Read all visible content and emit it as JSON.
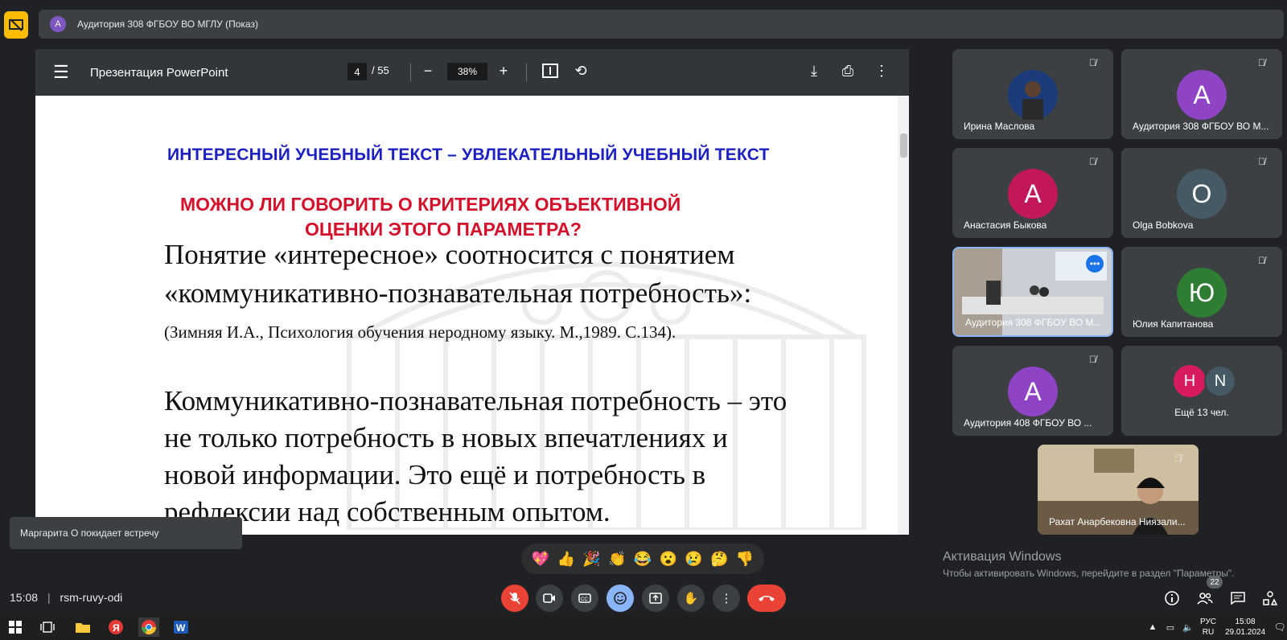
{
  "meeting": {
    "presenter_title": "Аудитория 308 ФГБОУ ВО МГЛУ (Показ)",
    "presenter_avatar": "A",
    "time": "15:08",
    "code": "rsm-ruvy-odi"
  },
  "pdf": {
    "title": "Презентация PowerPoint",
    "page_current": "4",
    "page_total": "55",
    "zoom": "38%"
  },
  "slide": {
    "heading1": "ИНТЕРЕСНЫЙ УЧЕБНЫЙ ТЕКСТ – УВЛЕКАТЕЛЬНЫЙ УЧЕБНЫЙ ТЕКСТ",
    "heading2_line1": "МОЖНО ЛИ ГОВОРИТЬ О КРИТЕРИЯХ ОБЪЕКТИВНОЙ",
    "heading2_line2": "ОЦЕНКИ ЭТОГО ПАРАМЕТРА?",
    "para1_line1": "Понятие «интересное»  соотносится с понятием",
    "para1_line2": "«коммуникативно-познавательная потребность»:",
    "citation": "(Зимняя И.А., Психология обучения неродному языку. М.,1989. С.134).",
    "para2_line1": "Коммуникативно-познавательная потребность – это",
    "para2_line2": "не  только  потребность  в  новых  впечатлениях  и",
    "para2_line3": "новой  информации.   Это  ещё  и   потребность  в",
    "para2_line4": "рефлексии над собственным опытом."
  },
  "participants": [
    {
      "name": "Ирина Маслова",
      "avatar": "",
      "color": "#1b3b7a"
    },
    {
      "name": "Аудитория 308 ФГБОУ ВО М...",
      "avatar": "A",
      "color": "#8e44c4"
    },
    {
      "name": "Анастасия Быкова",
      "avatar": "A",
      "color": "#c2185b"
    },
    {
      "name": "Olga Bobkova",
      "avatar": "O",
      "color": "#455a64"
    },
    {
      "name": "Аудитория 308 ФГБОУ ВО М...",
      "avatar": "",
      "color": "#c5cdd3"
    },
    {
      "name": "Юлия Капитанова",
      "avatar": "Ю",
      "color": "#2e7d32"
    },
    {
      "name": "Аудитория 408 ФГБОУ ВО ...",
      "avatar": "A",
      "color": "#8e44c4"
    },
    {
      "name": "Ещё 13 чел.",
      "avatar1": "H",
      "avatar2": "N",
      "color1": "#d81b60",
      "color2": "#455a64"
    }
  ],
  "self_view": {
    "name": "Рахат Анарбековна Ниязали..."
  },
  "toast": "Маргарита О покидает встречу",
  "reactions": [
    "💖",
    "👍",
    "🎉",
    "👏",
    "😂",
    "😮",
    "😢",
    "🤔",
    "👎"
  ],
  "windows": {
    "activation_title": "Активация Windows",
    "activation_sub": "Чтобы активировать Windows, перейдите в раздел \"Параметры\".",
    "lang": "РУС",
    "lang2": "RU",
    "clock_time": "15:08",
    "clock_date": "29.01.2024"
  },
  "people_count": "22",
  "colors": {
    "end_call": "#ea4335",
    "mic_off": "#ea4335",
    "emoji_active": "#8ab4f8"
  }
}
